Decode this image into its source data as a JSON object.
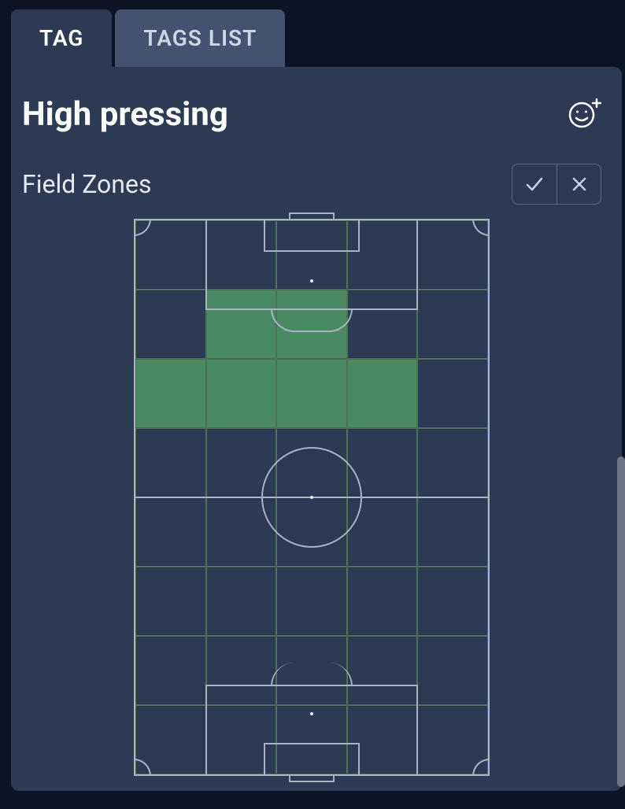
{
  "tabs": {
    "active": "TAG",
    "inactive": "TAGS LIST"
  },
  "title": "High pressing",
  "section_label": "Field Zones",
  "field": {
    "rows": 8,
    "cols": 5,
    "selected_cells": [
      [
        1,
        1
      ],
      [
        1,
        2
      ],
      [
        2,
        0
      ],
      [
        2,
        1
      ],
      [
        2,
        2
      ],
      [
        2,
        3
      ]
    ]
  },
  "icons": {
    "emoji_add": "emoji-add-icon",
    "confirm": "check-icon",
    "cancel": "x-icon"
  }
}
